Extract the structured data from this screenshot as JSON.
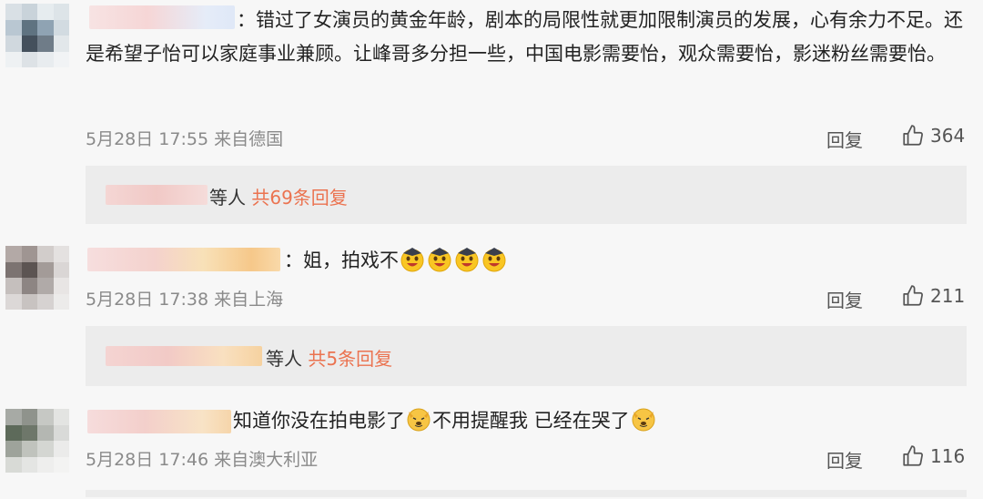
{
  "comments": [
    {
      "prefix": "：",
      "text": "错过了女演员的黄金年龄，剧本的局限性就更加限制演员的发展，心有余力不足。还是希望子怡可以家庭事业兼顾。让峰哥多分担一些，中国电影需要怡，观众需要怡，影迷粉丝需要怡。",
      "date": "5月28日 17:55",
      "source": "来自德国",
      "reply_label": "回复",
      "likes": "364",
      "thread": {
        "suffix": "等人",
        "count_text": "共69条回复"
      }
    },
    {
      "prefix": "：",
      "text": "姐，拍戏不",
      "emoji_count_note": "4",
      "date": "5月28日 17:38",
      "source": "来自上海",
      "reply_label": "回复",
      "likes": "211",
      "thread": {
        "suffix": "等人",
        "count_text": "共5条回复"
      }
    },
    {
      "text_a": "知道你没在拍电影了",
      "text_b": "不用提醒我 已经在哭了",
      "date": "5月28日 17:46",
      "source": "来自澳大利亚",
      "reply_label": "回复",
      "likes": "116"
    }
  ],
  "icons": {
    "like": "thumbs-up-icon",
    "emoji_1": "grin-cap-emoji-icon",
    "emoji_2": "dog-emoji-icon"
  },
  "colors": {
    "accent": "#eb7350",
    "meta": "#8a8a8a",
    "thread_bg": "#ececec"
  }
}
